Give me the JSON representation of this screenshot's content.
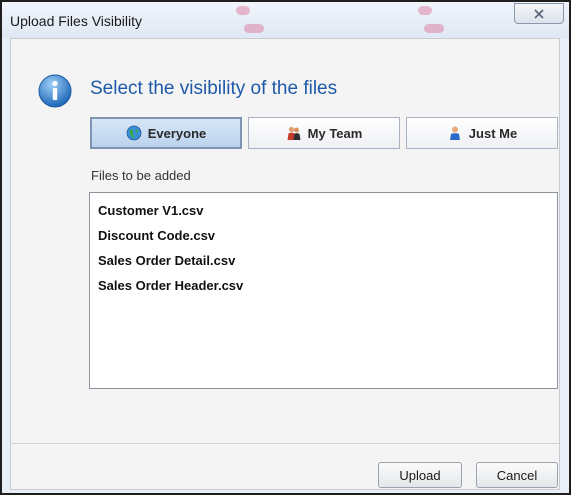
{
  "window": {
    "title": "Upload Files Visibility"
  },
  "dialog": {
    "heading": "Select the visibility of the files",
    "visibility_options": [
      {
        "label": "Everyone",
        "icon": "globe-icon",
        "selected": true
      },
      {
        "label": "My Team",
        "icon": "team-icon",
        "selected": false
      },
      {
        "label": "Just Me",
        "icon": "person-icon",
        "selected": false
      }
    ],
    "files_label": "Files to be added",
    "files": [
      "Customer V1.csv",
      "Discount Code.csv",
      "Sales Order Detail.csv",
      "Sales Order Header.csv"
    ]
  },
  "footer": {
    "upload_label": "Upload",
    "cancel_label": "Cancel"
  },
  "colors": {
    "heading": "#1f5aa8",
    "selected_option": "#c9dcf2",
    "window_frame": "#e9eff6"
  }
}
